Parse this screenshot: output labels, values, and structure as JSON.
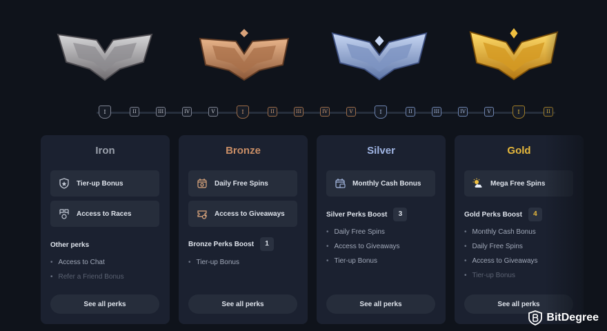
{
  "tiers": [
    {
      "name": "Iron",
      "color": "#9aa0ab",
      "perk_boxes": [
        {
          "label": "Tier-up Bonus",
          "icon": "shield-star-icon"
        },
        {
          "label": "Access to Races",
          "icon": "race-flags-icon"
        }
      ],
      "section_label": "Other perks",
      "perk_list": [
        "Access to Chat",
        "Refer a Friend Bonus"
      ],
      "see_all": "See all perks"
    },
    {
      "name": "Bronze",
      "color": "#c98e66",
      "perk_boxes": [
        {
          "label": "Daily Free Spins",
          "icon": "calendar-spins-icon"
        },
        {
          "label": "Access to Giveaways",
          "icon": "ticket-icon"
        }
      ],
      "section_label": "Bronze Perks Boost",
      "boost_count": "1",
      "perk_list": [
        "Tier-up Bonus"
      ],
      "see_all": "See all perks"
    },
    {
      "name": "Silver",
      "color": "#9fb4e2",
      "perk_boxes": [
        {
          "label": "Monthly Cash Bonus",
          "icon": "calendar-cash-icon"
        }
      ],
      "section_label": "Silver Perks Boost",
      "boost_count": "3",
      "perk_list": [
        "Daily Free Spins",
        "Access to Giveaways",
        "Tier-up Bonus"
      ],
      "see_all": "See all perks"
    },
    {
      "name": "Gold",
      "color": "#e6b83c",
      "perk_boxes": [
        {
          "label": "Mega Free Spins",
          "icon": "sun-cloud-icon"
        }
      ],
      "section_label": "Gold Perks Boost",
      "boost_count": "4",
      "perk_list": [
        "Monthly Cash Bonus",
        "Daily Free Spins",
        "Access to Giveaways",
        "Tier-up Bonus"
      ],
      "see_all": "See all perks"
    }
  ],
  "track_labels": [
    "I",
    "II",
    "III",
    "IV",
    "V"
  ],
  "logo": {
    "text": "BitDegree",
    "icon": "bitdegree-shield-icon"
  }
}
